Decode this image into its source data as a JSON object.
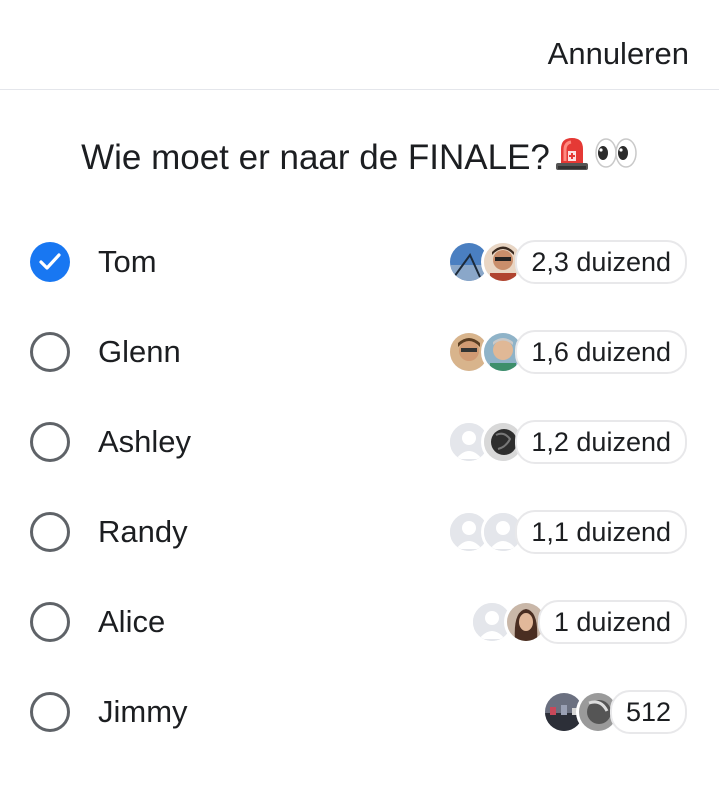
{
  "header": {
    "cancel_label": "Annuleren"
  },
  "poll": {
    "question": "Wie moet er naar de FINALE?",
    "question_emoji": [
      "police-siren-light",
      "eyes"
    ],
    "selected_index": 0,
    "options": [
      {
        "label": "Tom",
        "count": "2,3 duizend",
        "checked": true,
        "avatars": [
          "avatar-photo",
          "avatar-face"
        ]
      },
      {
        "label": "Glenn",
        "count": "1,6 duizend",
        "checked": false,
        "avatars": [
          "avatar-face",
          "avatar-face"
        ]
      },
      {
        "label": "Ashley",
        "count": "1,2 duizend",
        "checked": false,
        "avatars": [
          "avatar-placeholder",
          "avatar-dark"
        ]
      },
      {
        "label": "Randy",
        "count": "1,1 duizend",
        "checked": false,
        "avatars": [
          "avatar-placeholder",
          "avatar-placeholder"
        ]
      },
      {
        "label": "Alice",
        "count": "1 duizend",
        "checked": false,
        "avatars": [
          "avatar-placeholder",
          "avatar-face"
        ]
      },
      {
        "label": "Jimmy",
        "count": "512",
        "checked": false,
        "avatars": [
          "avatar-photo",
          "avatar-dark"
        ]
      }
    ]
  },
  "colors": {
    "accent": "#1877f2",
    "radio_border": "#5f6368",
    "text": "#1c1e21",
    "divider": "#e4e6eb"
  }
}
